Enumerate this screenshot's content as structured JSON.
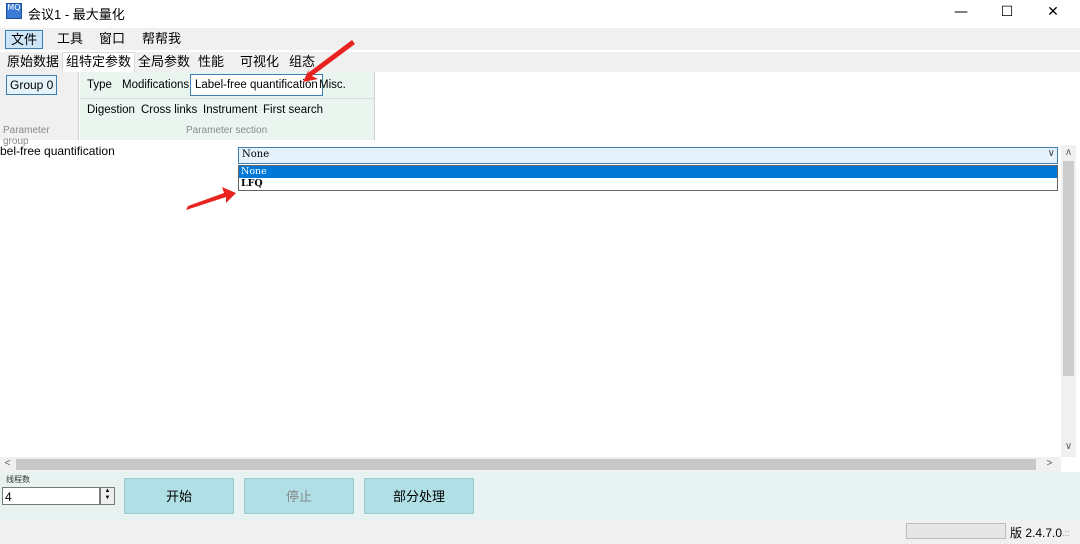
{
  "window": {
    "icon_text": "MQ",
    "title": "会议1 - 最大量化",
    "minimize": "—",
    "maximize": "☐",
    "close": "✕"
  },
  "menu": [
    "文件",
    "工具",
    "窗口",
    "帮帮我"
  ],
  "tabs": [
    "原始数据",
    "组特定参数",
    "全局参数",
    "性能",
    "可视化",
    "组态"
  ],
  "parameter_group": {
    "button": "Group 0",
    "label": "Parameter group"
  },
  "parameter_section": {
    "row1": [
      "Type",
      "Modifications",
      "Label-free quantification",
      "Misc."
    ],
    "row2": [
      "Digestion",
      "Cross links",
      "Instrument",
      "First search"
    ],
    "label": "Parameter section"
  },
  "field": {
    "label": "bel-free quantification",
    "value": "None",
    "options": [
      "None",
      "LFQ"
    ]
  },
  "bottom": {
    "threads_label": "线程数",
    "threads_value": "4",
    "start": "开始",
    "stop": "停止",
    "partial": "部分处理"
  },
  "status": {
    "version": "版 2.4.7.0",
    "grip": ".::"
  },
  "colors": {
    "accent": "#0078d7",
    "button_bg": "#b0e0e6",
    "annotation_arrow": "#e8231f"
  }
}
